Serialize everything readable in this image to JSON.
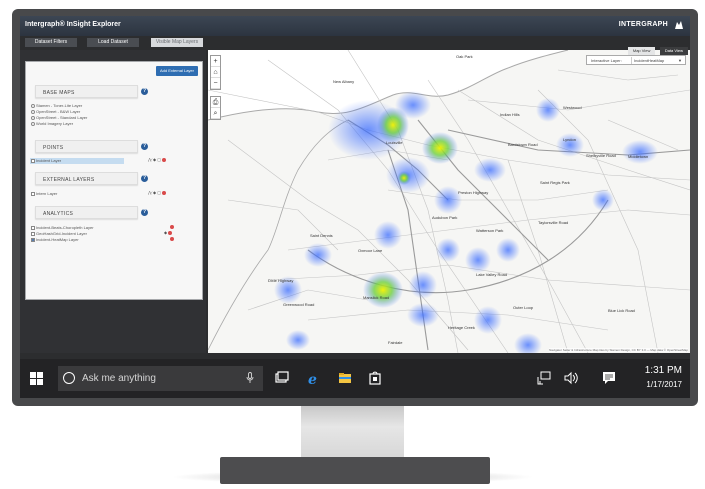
{
  "app": {
    "title": "Intergraph® InSight Explorer",
    "brand": "INTERGRAPH"
  },
  "tabs": [
    "Dataset Filters",
    "Load Dataset",
    "Visible Map Layers"
  ],
  "panel": {
    "add_layer": "Add External Layer",
    "base_maps": {
      "title": "BASE MAPS",
      "options": [
        "Stamen - Toner-Lite Layer",
        "OpenStreet - B&W Layer",
        "OpenStreet - Standard Layer",
        "World Imagery Layer"
      ]
    },
    "points": {
      "title": "POINTS",
      "items": [
        "Incident Layer"
      ]
    },
    "external_layers": {
      "title": "EXTERNAL LAYERS",
      "items": [
        "Intern Layer"
      ]
    },
    "analytics": {
      "title": "ANALYTICS",
      "items": [
        "Incident-Beats-Choropleth Layer",
        "GeoHashGrid-Incident Layer",
        "Incident-HeatMap Layer"
      ]
    }
  },
  "map": {
    "view_tabs": [
      "Map View",
      "Data View"
    ],
    "interactive_label": "Interactive Layer:",
    "interactive_value": "IncidentHeatMap",
    "attribution": "Navigator Seiler & Infrastructure  Map tiles by Stamen Design, CC BY 3.0 — Map data © OpenStreetMap",
    "labels": [
      {
        "t": "Oak Park"
      },
      {
        "t": "New Albany"
      },
      {
        "t": "Indian Hills"
      },
      {
        "t": "Westwood"
      },
      {
        "t": "Louisville"
      },
      {
        "t": "Lyndon"
      },
      {
        "t": "Middletown"
      },
      {
        "t": "Saint Regis Park"
      },
      {
        "t": "Audubon Park"
      },
      {
        "t": "Watterson Park"
      },
      {
        "t": "Saint Dennis"
      },
      {
        "t": "Oxmoor Lane"
      },
      {
        "t": "Lake Valley Road"
      },
      {
        "t": "Dixie Highway"
      },
      {
        "t": "Heritage Creek"
      },
      {
        "t": "Fairdale"
      },
      {
        "t": "Greenwood Road"
      },
      {
        "t": "Shelbyville Road"
      },
      {
        "t": "Outer Loop"
      },
      {
        "t": "Preston Highway"
      },
      {
        "t": "Bardstown Road"
      },
      {
        "t": "Taylorsville Road"
      },
      {
        "t": "Manslick Road"
      },
      {
        "t": "Blue Lick Road"
      }
    ]
  },
  "taskbar": {
    "search_placeholder": "Ask me anything",
    "time": "1:31 PM",
    "date": "1/17/2017"
  }
}
